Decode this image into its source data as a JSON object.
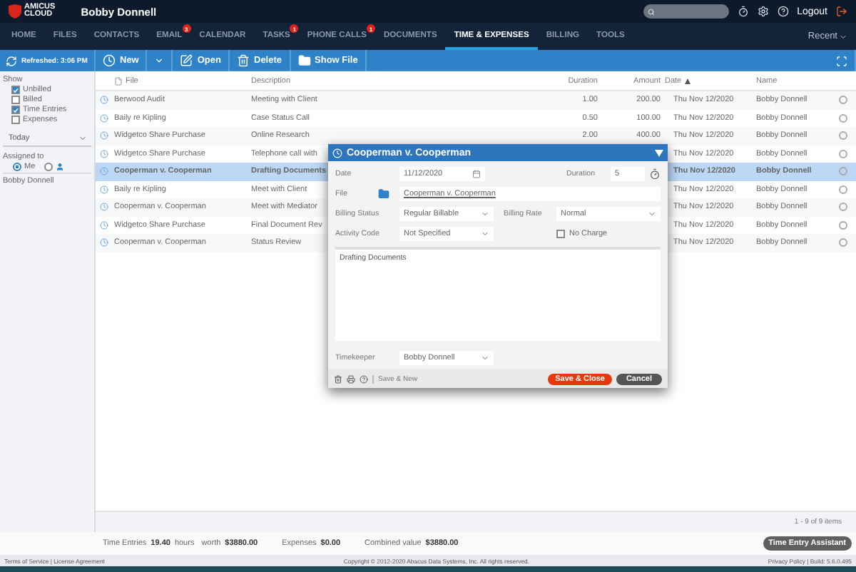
{
  "header": {
    "brand": "AMICUS",
    "brand_sub": "CLOUD",
    "user": "Bobby Donnell",
    "logout": "Logout"
  },
  "nav": {
    "tabs": [
      {
        "label": "HOME",
        "selected": false
      },
      {
        "label": "FILES",
        "selected": false
      },
      {
        "label": "CONTACTS",
        "selected": false
      },
      {
        "label": "EMAIL",
        "selected": false,
        "badge": "3"
      },
      {
        "label": "CALENDAR",
        "selected": false
      },
      {
        "label": "TASKS",
        "selected": false,
        "badge": "1"
      },
      {
        "label": "PHONE CALLS",
        "selected": false,
        "badge": "1"
      },
      {
        "label": "DOCUMENTS",
        "selected": false
      },
      {
        "label": "TIME & EXPENSES",
        "selected": true
      },
      {
        "label": "BILLING",
        "selected": false
      },
      {
        "label": "TOOLS",
        "selected": false
      }
    ],
    "recent": "Recent"
  },
  "toolbar": {
    "refreshed": "Refreshed: 3:06 PM",
    "buttons": [
      {
        "kind": "new",
        "label": "New"
      },
      {
        "kind": "open",
        "label": "Open"
      },
      {
        "kind": "delete",
        "label": "Delete"
      },
      {
        "kind": "show_file",
        "label": "Show File"
      }
    ]
  },
  "sidebar": {
    "show_label": "Show",
    "filters": [
      {
        "label": "Unbilled",
        "checked": true
      },
      {
        "label": "Billed",
        "checked": false
      },
      {
        "label": "Time Entries",
        "checked": true
      },
      {
        "label": "Expenses",
        "checked": false
      }
    ],
    "period": "Today",
    "assigned_label": "Assigned to",
    "assignees": [
      {
        "kind": "me",
        "label": "Me",
        "selected": true
      },
      {
        "kind": "person",
        "selected": false
      }
    ],
    "assignee_name": "Bobby Donnell"
  },
  "table": {
    "columns": [
      {
        "label": "File",
        "sorted": false
      },
      {
        "label": "Description",
        "sorted": false
      },
      {
        "label": "Duration",
        "sorted": false
      },
      {
        "label": "Amount",
        "sorted": false
      },
      {
        "label": "Date",
        "sorted": true
      },
      {
        "label": "Name",
        "sorted": false
      }
    ],
    "rows": [
      {
        "file": "Berwood Audit",
        "description": "Meeting with Client",
        "duration": "1.00",
        "amount": "200.00",
        "date": "Thu Nov 12/2020",
        "name": "Bobby Donnell",
        "selected": false,
        "checked": false
      },
      {
        "file": "Baily re Kipling",
        "description": "Case Status Call",
        "duration": "0.50",
        "amount": "100.00",
        "date": "Thu Nov 12/2020",
        "name": "Bobby Donnell",
        "selected": false,
        "checked": false
      },
      {
        "file": "Widgetco Share Purchase",
        "description": "Online Research",
        "duration": "2.00",
        "amount": "400.00",
        "date": "Thu Nov 12/2020",
        "name": "Bobby Donnell",
        "selected": false,
        "checked": false
      },
      {
        "file": "Widgetco Share Purchase",
        "description": "Telephone call with",
        "date": "Thu Nov 12/2020",
        "name": "Bobby Donnell",
        "selected": false,
        "checked": false
      },
      {
        "file": "Cooperman v. Cooperman",
        "description": "Drafting Documents",
        "date": "Thu Nov 12/2020",
        "name": "Bobby Donnell",
        "selected": true,
        "checked": false
      },
      {
        "file": "Baily re Kipling",
        "description": "Meet with Client",
        "date": "Thu Nov 12/2020",
        "name": "Bobby Donnell",
        "selected": false,
        "checked": false
      },
      {
        "file": "Cooperman v. Cooperman",
        "description": "Meet with Mediator",
        "date": "Thu Nov 12/2020",
        "name": "Bobby Donnell",
        "selected": false,
        "checked": false
      },
      {
        "file": "Widgetco Share Purchase",
        "description": "Final Document Rev",
        "date": "Thu Nov 12/2020",
        "name": "Bobby Donnell",
        "selected": false,
        "checked": false
      },
      {
        "file": "Cooperman v. Cooperman",
        "description": "Status Review",
        "date": "Thu Nov 12/2020",
        "name": "Bobby Donnell",
        "selected": false,
        "checked": false
      }
    ]
  },
  "pager": "1 - 9 of 9 items",
  "summary": {
    "entries_label": "Time Entries",
    "hours": "19.40",
    "hours_label": "hours",
    "worth_label": "worth",
    "worth": "$3880.00",
    "expenses_label": "Expenses",
    "expenses": "$0.00",
    "combined_label": "Combined value",
    "combined": "$3880.00",
    "assistant": "Time Entry Assistant"
  },
  "dialog": {
    "title": "Cooperman v. Cooperman",
    "date_label": "Date",
    "date": "11/12/2020",
    "duration_label": "Duration",
    "duration": "5",
    "file_label": "File",
    "file": "Cooperman v. Cooperman",
    "billing_status_label": "Billing Status",
    "billing_status": "Regular Billable",
    "billing_rate_label": "Billing Rate",
    "billing_rate": "Normal",
    "activity_label": "Activity Code",
    "activity": "Not Specified",
    "no_charge_label": "No Charge",
    "no_charge": false,
    "notes": "Drafting Documents",
    "timekeeper_label": "Timekeeper",
    "timekeeper": "Bobby Donnell",
    "save_new": "Save & New",
    "save_close": "Save & Close",
    "cancel": "Cancel"
  },
  "footer": {
    "left": "Terms of Service | License Agreement",
    "center": "Copyright © 2012-2020 Abacus Data Systems, Inc. All rights reserved.",
    "right": "Privacy Policy | Build: 5.6.0.495"
  }
}
